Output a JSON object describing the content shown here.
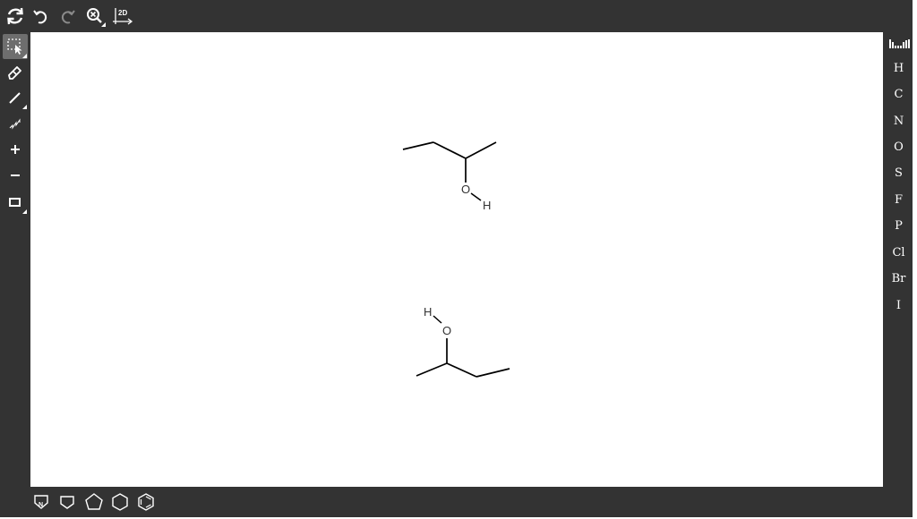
{
  "top_toolbar": {
    "tools": [
      {
        "name": "clear-canvas",
        "icon": "refresh-icon"
      },
      {
        "name": "undo",
        "icon": "undo-icon"
      },
      {
        "name": "redo",
        "icon": "redo-icon"
      },
      {
        "name": "zoom",
        "icon": "zoom-icon"
      },
      {
        "name": "clean-2d",
        "icon": "clean-2d-icon",
        "label": "2D"
      }
    ]
  },
  "left_toolbar": {
    "tools": [
      {
        "name": "select",
        "icon": "select-icon",
        "selected": true
      },
      {
        "name": "erase",
        "icon": "eraser-icon"
      },
      {
        "name": "bond",
        "icon": "bond-icon"
      },
      {
        "name": "chain",
        "icon": "chain-icon"
      },
      {
        "name": "charge-plus",
        "icon": "plus-icon",
        "label": "+"
      },
      {
        "name": "charge-minus",
        "icon": "minus-icon",
        "label": "−"
      },
      {
        "name": "shape",
        "icon": "rectangle-icon"
      }
    ]
  },
  "right_toolbar": {
    "periodic_table_icon": "periodic-table-icon",
    "elements": [
      "H",
      "C",
      "N",
      "O",
      "S",
      "F",
      "P",
      "Cl",
      "Br",
      "I"
    ]
  },
  "bottom_toolbar": {
    "templates": [
      {
        "name": "custom-ring",
        "icon": "custom-template-icon",
        "label": "N"
      },
      {
        "name": "cyclobutane",
        "icon": "square-ring-icon"
      },
      {
        "name": "cyclopentane",
        "icon": "pentagon-ring-icon"
      },
      {
        "name": "cyclohexane",
        "icon": "hexagon-ring-icon"
      },
      {
        "name": "benzene",
        "icon": "benzene-ring-icon"
      }
    ]
  },
  "canvas": {
    "molecules": [
      {
        "name": "butan-2-ol-1",
        "atoms": {
          "oxygen": "O",
          "hydrogen": "H"
        }
      },
      {
        "name": "butan-2-ol-2",
        "atoms": {
          "oxygen": "O",
          "hydrogen": "H"
        }
      }
    ]
  },
  "colors": {
    "toolbar_bg": "#333333",
    "canvas_bg": "#ffffff",
    "selected_bg": "#6e6e6e",
    "bond": "#000000",
    "atom": "#333333"
  }
}
